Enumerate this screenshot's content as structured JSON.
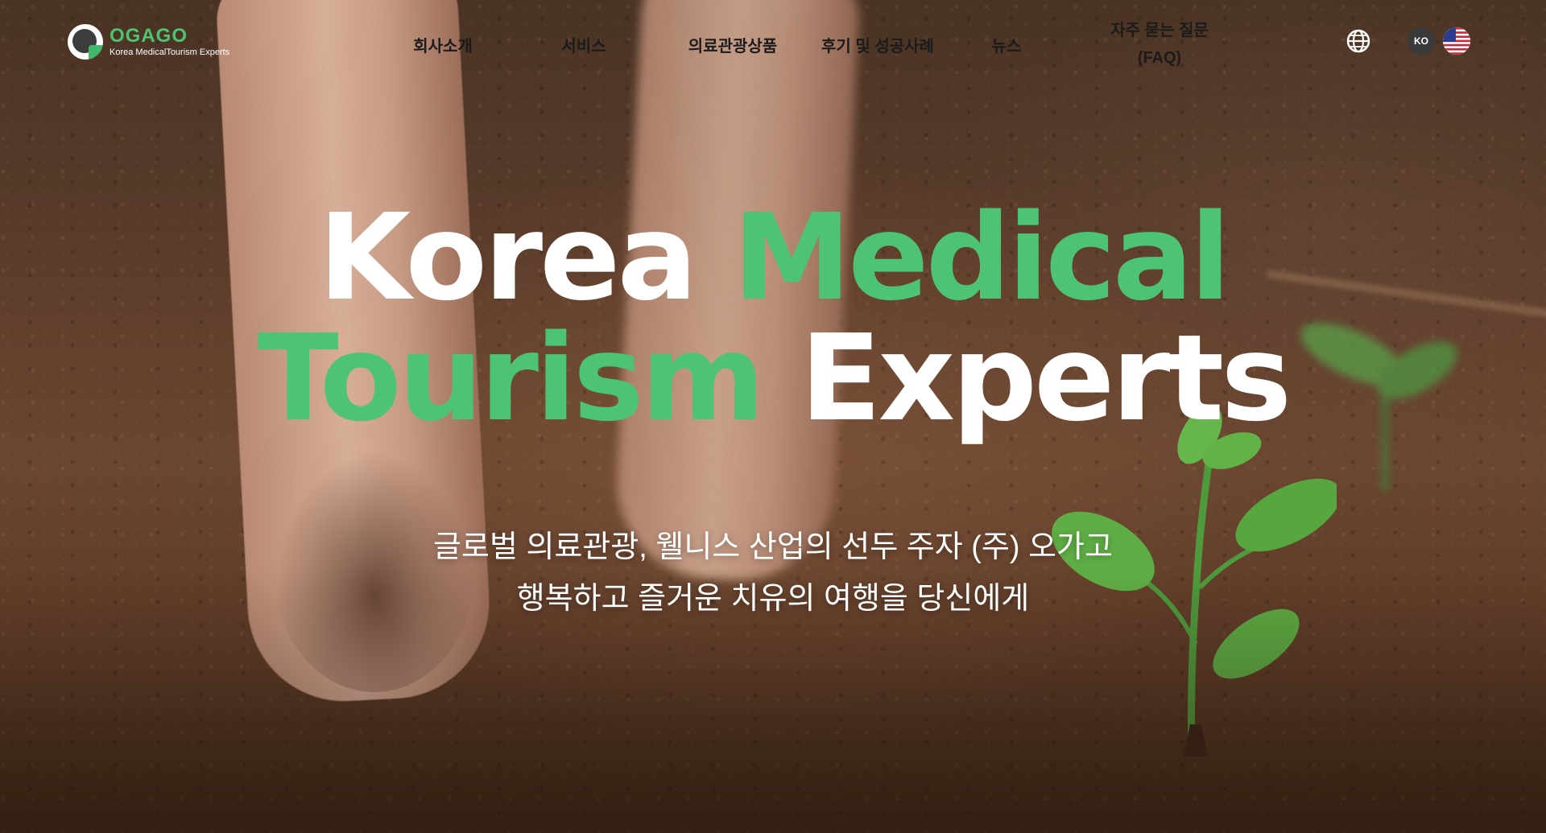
{
  "logo": {
    "brand": "OGAGO",
    "tagline": "Korea MedicalTourism Experts"
  },
  "nav": {
    "items": [
      {
        "label": "회사소개"
      },
      {
        "label": "서비스"
      },
      {
        "label": "의료관광상품"
      },
      {
        "label": "후기 및 성공사례"
      },
      {
        "label": "뉴스"
      },
      {
        "label": "자주 묻는 질문",
        "label2": "(FAQ)"
      }
    ]
  },
  "utility": {
    "language_icon": "globe-icon",
    "ko_label": "KO",
    "us_flag_icon": "us-flag-icon"
  },
  "hero": {
    "line1_white": "Korea ",
    "line1_green": "Medical",
    "line2_green": "Tourism ",
    "line2_white": "Experts",
    "subtitle_line1": "글로벌 의료관광, 웰니스 산업의 선두 주자 (주) 오가고",
    "subtitle_line2": "행복하고 즐거운 치유의 여행을 당신에게"
  },
  "colors": {
    "accent_green": "#4cc474",
    "nav_text": "#1b1b1b",
    "headline_white": "#ffffff"
  }
}
